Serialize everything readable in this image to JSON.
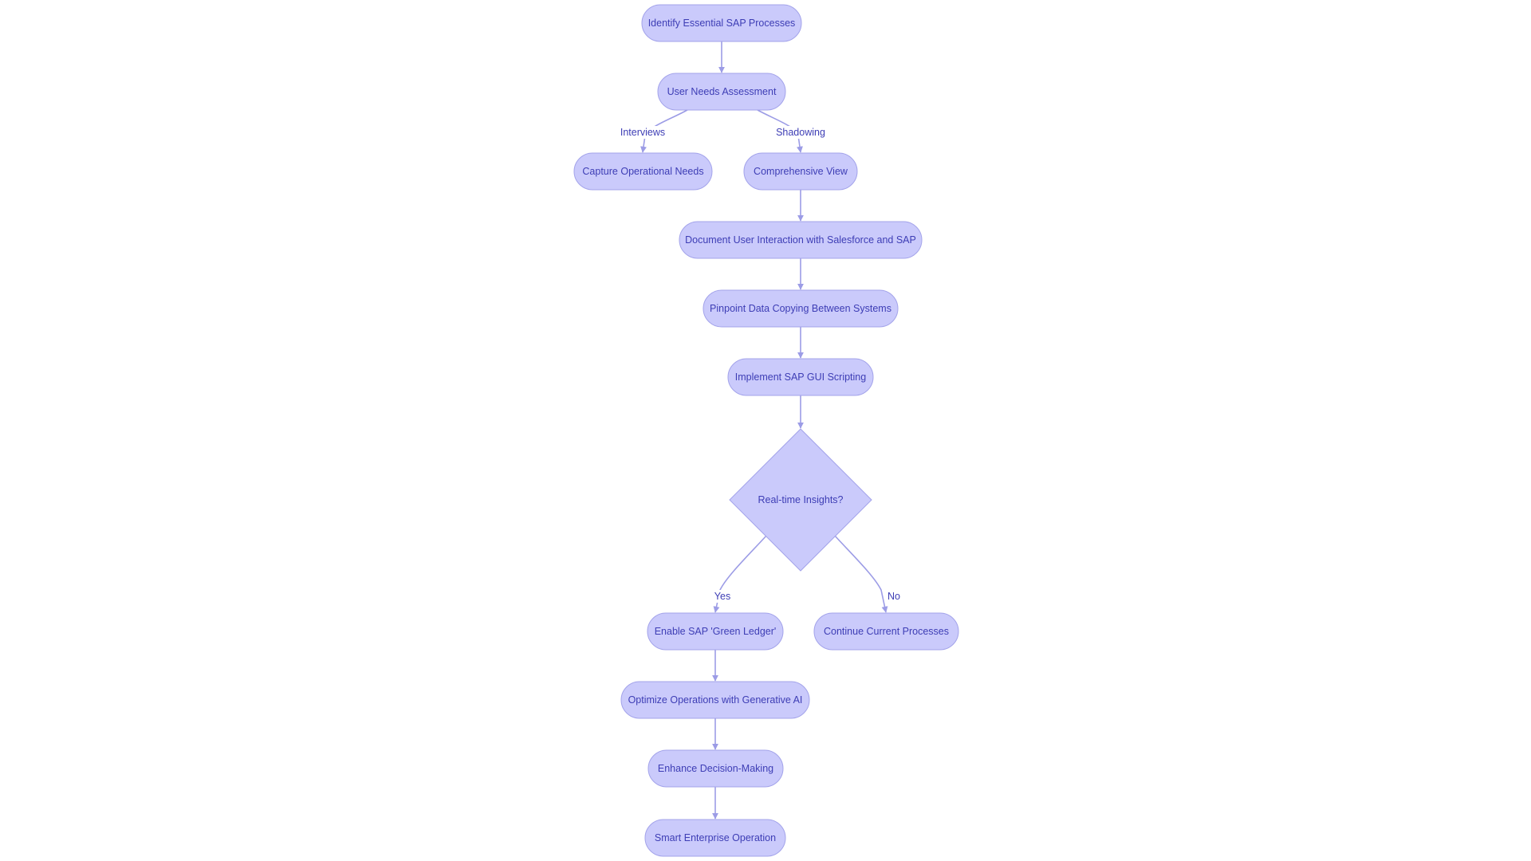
{
  "diagram": {
    "type": "flowchart",
    "colors": {
      "node_fill": "#cacafb",
      "node_stroke": "#a3a3ea",
      "text": "#3d3db5",
      "edge": "#9c9ce6"
    },
    "nodes": [
      {
        "id": "identify",
        "label": "Identify Essential SAP Processes",
        "shape": "stadium"
      },
      {
        "id": "user_needs",
        "label": "User Needs Assessment",
        "shape": "stadium"
      },
      {
        "id": "capture",
        "label": "Capture Operational Needs",
        "shape": "stadium"
      },
      {
        "id": "comprehensive",
        "label": "Comprehensive View",
        "shape": "stadium"
      },
      {
        "id": "document",
        "label": "Document User Interaction with Salesforce and SAP",
        "shape": "stadium"
      },
      {
        "id": "pinpoint",
        "label": "Pinpoint Data Copying Between Systems",
        "shape": "stadium"
      },
      {
        "id": "implement",
        "label": "Implement SAP GUI Scripting",
        "shape": "stadium"
      },
      {
        "id": "decision",
        "label": "Real-time Insights?",
        "shape": "diamond"
      },
      {
        "id": "enable",
        "label": "Enable SAP 'Green Ledger'",
        "shape": "stadium"
      },
      {
        "id": "continue",
        "label": "Continue Current Processes",
        "shape": "stadium"
      },
      {
        "id": "optimize",
        "label": "Optimize Operations with Generative AI",
        "shape": "stadium"
      },
      {
        "id": "enhance",
        "label": "Enhance Decision-Making",
        "shape": "stadium"
      },
      {
        "id": "smart",
        "label": "Smart Enterprise Operation",
        "shape": "stadium"
      }
    ],
    "edges": [
      {
        "from": "identify",
        "to": "user_needs",
        "label": ""
      },
      {
        "from": "user_needs",
        "to": "capture",
        "label": "Interviews"
      },
      {
        "from": "user_needs",
        "to": "comprehensive",
        "label": "Shadowing"
      },
      {
        "from": "comprehensive",
        "to": "document",
        "label": ""
      },
      {
        "from": "document",
        "to": "pinpoint",
        "label": ""
      },
      {
        "from": "pinpoint",
        "to": "implement",
        "label": ""
      },
      {
        "from": "implement",
        "to": "decision",
        "label": ""
      },
      {
        "from": "decision",
        "to": "enable",
        "label": "Yes"
      },
      {
        "from": "decision",
        "to": "continue",
        "label": "No"
      },
      {
        "from": "enable",
        "to": "optimize",
        "label": ""
      },
      {
        "from": "optimize",
        "to": "enhance",
        "label": ""
      },
      {
        "from": "enhance",
        "to": "smart",
        "label": ""
      }
    ]
  }
}
